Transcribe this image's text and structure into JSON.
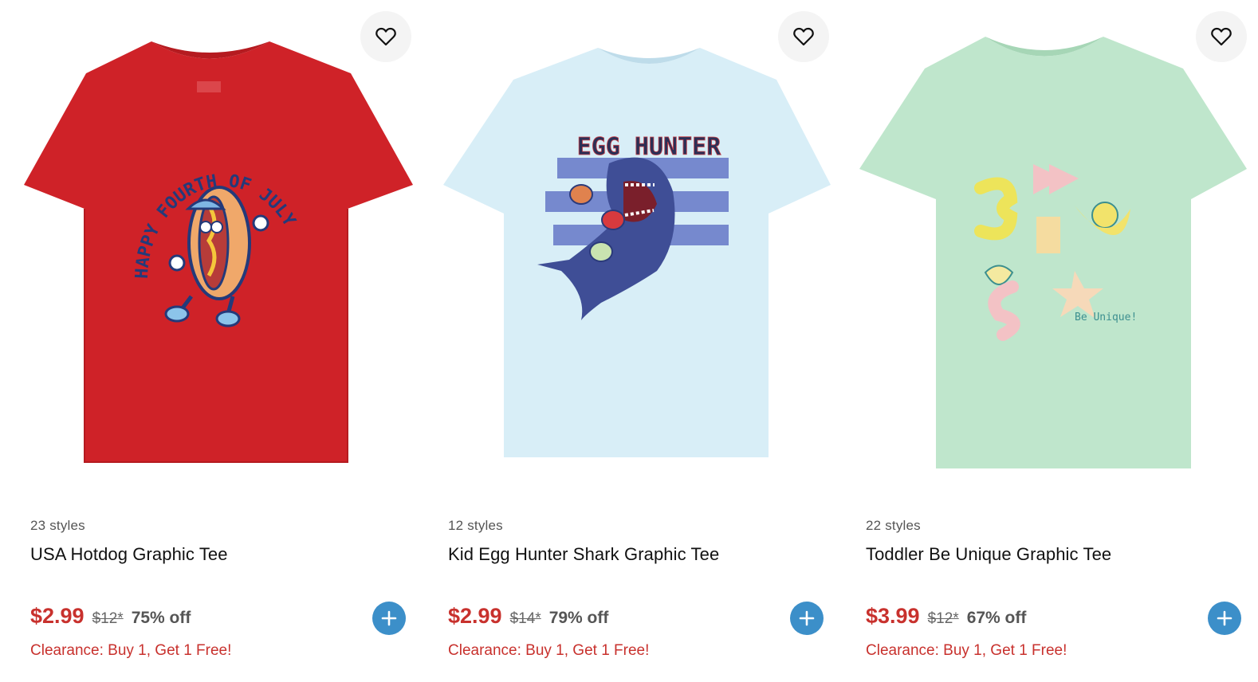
{
  "colors": {
    "sale_price": "#c8312d",
    "promo": "#c8312d",
    "add_button": "#3c8fc9",
    "fav_button_bg": "#f4f4f4"
  },
  "products": [
    {
      "styles": "23 styles",
      "name": "USA Hotdog Graphic Tee",
      "sale_price": "$2.99",
      "original_price": "$12*",
      "discount": "75% off",
      "promo": "Clearance: Buy 1, Get 1 Free!",
      "shirt_color": "#cf2228",
      "graphic_text": "HAPPY FOURTH OF JULY",
      "icons": {
        "favorite": "heart-icon",
        "add": "plus-icon"
      }
    },
    {
      "styles": "12 styles",
      "name": "Kid Egg Hunter Shark Graphic Tee",
      "sale_price": "$2.99",
      "original_price": "$14*",
      "discount": "79% off",
      "promo": "Clearance: Buy 1, Get 1 Free!",
      "shirt_color": "#d8eef7",
      "graphic_text": "EGG HUNTER",
      "icons": {
        "favorite": "heart-icon",
        "add": "plus-icon"
      }
    },
    {
      "styles": "22 styles",
      "name": "Toddler Be Unique Graphic Tee",
      "sale_price": "$3.99",
      "original_price": "$12*",
      "discount": "67% off",
      "promo": "Clearance: Buy 1, Get 1 Free!",
      "shirt_color": "#bfe6cc",
      "graphic_text": "Be Unique!",
      "icons": {
        "favorite": "heart-icon",
        "add": "plus-icon"
      }
    }
  ]
}
